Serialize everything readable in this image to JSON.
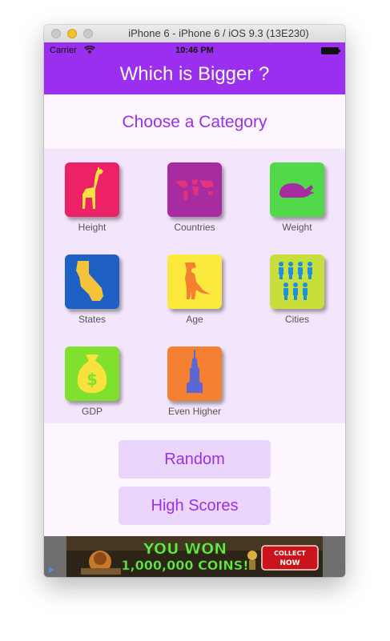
{
  "window": {
    "title": "iPhone 6 - iPhone 6 / iOS 9.3 (13E230)"
  },
  "status_bar": {
    "carrier": "Carrier",
    "time": "10:46 PM"
  },
  "nav": {
    "title": "Which is Bigger ?"
  },
  "main": {
    "heading": "Choose a Category",
    "categories": [
      {
        "label": "Height",
        "color": "#ec2166",
        "icon": "giraffe-icon"
      },
      {
        "label": "Countries",
        "color": "#a62ca0",
        "icon": "world-map-icon"
      },
      {
        "label": "Weight",
        "color": "#52d94a",
        "icon": "whale-icon"
      },
      {
        "label": "States",
        "color": "#1f60c4",
        "icon": "california-icon"
      },
      {
        "label": "Age",
        "color": "#fce93d",
        "icon": "dinosaur-icon"
      },
      {
        "label": "Cities",
        "color": "#c8de3a",
        "icon": "people-icon"
      },
      {
        "label": "GDP",
        "color": "#7fe02d",
        "icon": "money-bag-icon"
      },
      {
        "label": "Even Higher",
        "color": "#f58032",
        "icon": "skyscraper-icon"
      }
    ],
    "buttons": {
      "random": "Random",
      "high_scores": "High Scores"
    }
  },
  "ad": {
    "headline_1": "YOU WON",
    "headline_2": "1,000,000 COINS!",
    "cta": "COLLECT NOW"
  },
  "colors": {
    "accent": "#9b2ff0",
    "heading": "#9d2fe6",
    "button_bg": "#ead5fb"
  }
}
